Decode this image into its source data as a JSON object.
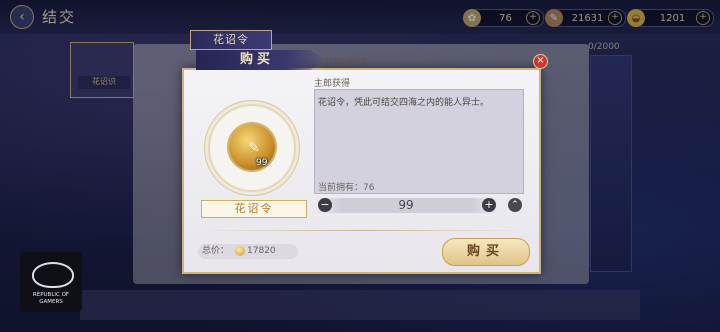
{
  "header": {
    "back_icon": "back-arrow-icon",
    "title": "结交",
    "resources": [
      {
        "icon": "flower-token-icon",
        "value": "76"
      },
      {
        "icon": "feather-icon",
        "value": "21631"
      },
      {
        "icon": "gold-ingot-icon",
        "value": "1201"
      }
    ]
  },
  "background": {
    "tab_label": "花诏令",
    "tab2_label": "获取途径",
    "side_count": "0/2000",
    "portrait_tag": "花诏识"
  },
  "modal": {
    "title": "购买",
    "source_label": "主郎获得",
    "item": {
      "name": "花诏令",
      "quantity_badge": "99",
      "description": "花诏令，凭此可结交四海之内的能人异士。",
      "owned_text": "当前拥有：76"
    },
    "stepper": {
      "minus": "−",
      "value": "99",
      "plus": "+",
      "max": "⌃"
    },
    "total_label": "总价：",
    "total_value": "17820",
    "buy_label": "购买"
  },
  "watermark": {
    "brand_text": "REPUBLIC OF GAMERS"
  },
  "colors": {
    "accent_gold": "#c9b482",
    "close_red": "#c33a2e",
    "modal_bg": "#f4f3f6"
  }
}
